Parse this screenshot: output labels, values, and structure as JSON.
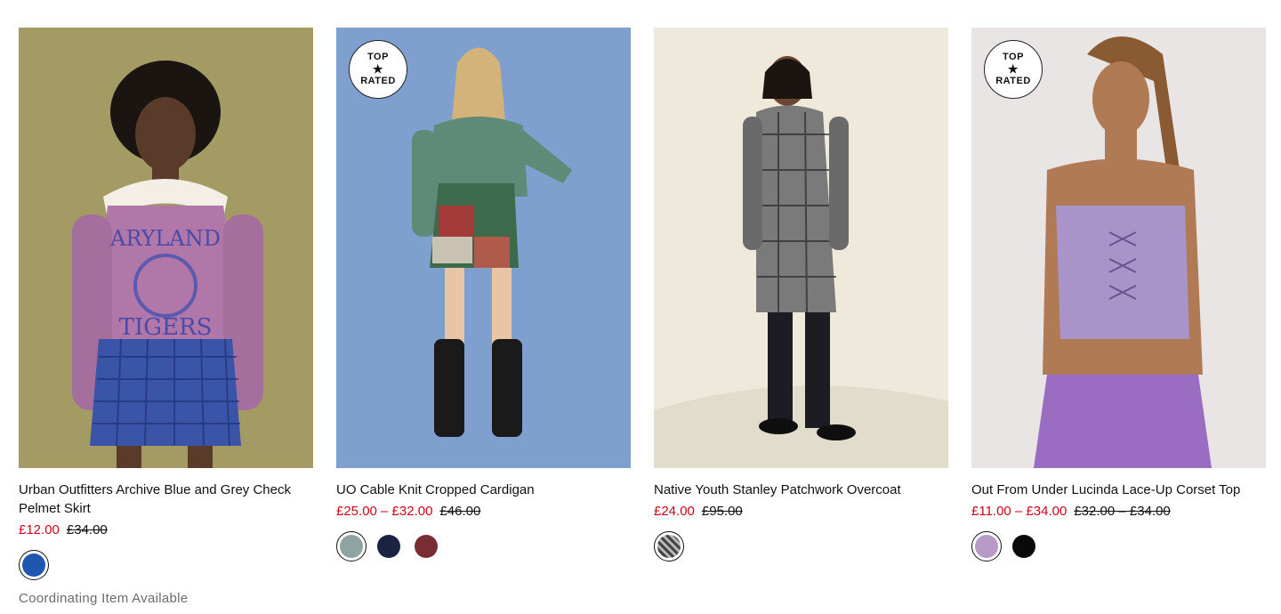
{
  "products": [
    {
      "title": "Urban Outfitters Archive Blue and Grey Check Pelmet Skirt",
      "sale_price": "£12.00",
      "original_price": "£34.00",
      "badge": null,
      "swatches": [
        {
          "name": "blue",
          "color": "#1f56b0",
          "selected": true
        }
      ],
      "note": "Coordinating Item Available",
      "image_bg": "#a39b63"
    },
    {
      "title": "UO Cable Knit Cropped Cardigan",
      "sale_price": "£25.00 – £32.00",
      "original_price": "£46.00",
      "badge": {
        "line1": "TOP",
        "line2": "RATED"
      },
      "swatches": [
        {
          "name": "sage",
          "color": "#8fa3a2",
          "selected": true
        },
        {
          "name": "navy",
          "color": "#1a2340",
          "selected": false
        },
        {
          "name": "burgundy",
          "color": "#7a2c33",
          "selected": false
        }
      ],
      "image_bg": "#7f9fcf"
    },
    {
      "title": "Native Youth Stanley Patchwork Overcoat",
      "sale_price": "£24.00",
      "original_price": "£95.00",
      "badge": null,
      "swatches": [
        {
          "name": "grey-check",
          "color": "#8a8a8a",
          "selected": true
        }
      ],
      "image_bg": "#ece6d8"
    },
    {
      "title": "Out From Under Lucinda Lace-Up Corset Top",
      "sale_price": "£11.00 – £34.00",
      "original_price": "£32.00 – £34.00",
      "badge": {
        "line1": "TOP",
        "line2": "RATED"
      },
      "swatches": [
        {
          "name": "lilac",
          "color": "#b79bc6",
          "selected": true
        },
        {
          "name": "black",
          "color": "#0a0a0a",
          "selected": false
        }
      ],
      "image_bg": "#e9e5e4"
    }
  ]
}
